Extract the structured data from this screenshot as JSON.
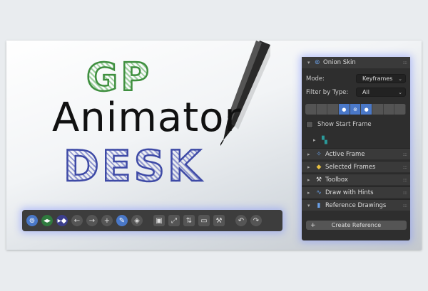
{
  "logo": {
    "line1": "GP",
    "line2": "Animator",
    "line3": "DESK"
  },
  "panel": {
    "title": "Onion Skin",
    "mode_label": "Mode:",
    "mode_value": "Keyframes",
    "filter_label": "Filter by Type:",
    "filter_value": "All",
    "show_start_frame": "Show Start Frame",
    "sections": [
      {
        "label": "Active Frame",
        "icon": "keyframe-diamond-icon"
      },
      {
        "label": "Selected Frames",
        "icon": "keyframe-diamond-icon"
      },
      {
        "label": "Toolbox",
        "icon": "toolbox-icon"
      },
      {
        "label": "Draw with Hints",
        "icon": "brush-stroke-icon"
      },
      {
        "label": "Reference Drawings",
        "icon": "bookmark-icon"
      }
    ],
    "create_reference": "Create Reference"
  },
  "toolbar": {
    "buttons": [
      "onion-skin-icon",
      "prev-keyframe-icon",
      "next-keyframe-icon",
      "arrow-left-icon",
      "arrow-right-icon",
      "plus-icon",
      "pencil-icon",
      "eraser-icon",
      "frame-icon",
      "resize-icon",
      "layers-icon",
      "window-icon",
      "toolbox-icon",
      "undo-icon",
      "redo-icon"
    ]
  },
  "colors": {
    "accent": "#4a78c8",
    "panel_bg": "#2e2e2e",
    "glow": "#7c8cff",
    "gp_green": "#3f8f3f",
    "desk_blue": "#3e4aa6"
  }
}
